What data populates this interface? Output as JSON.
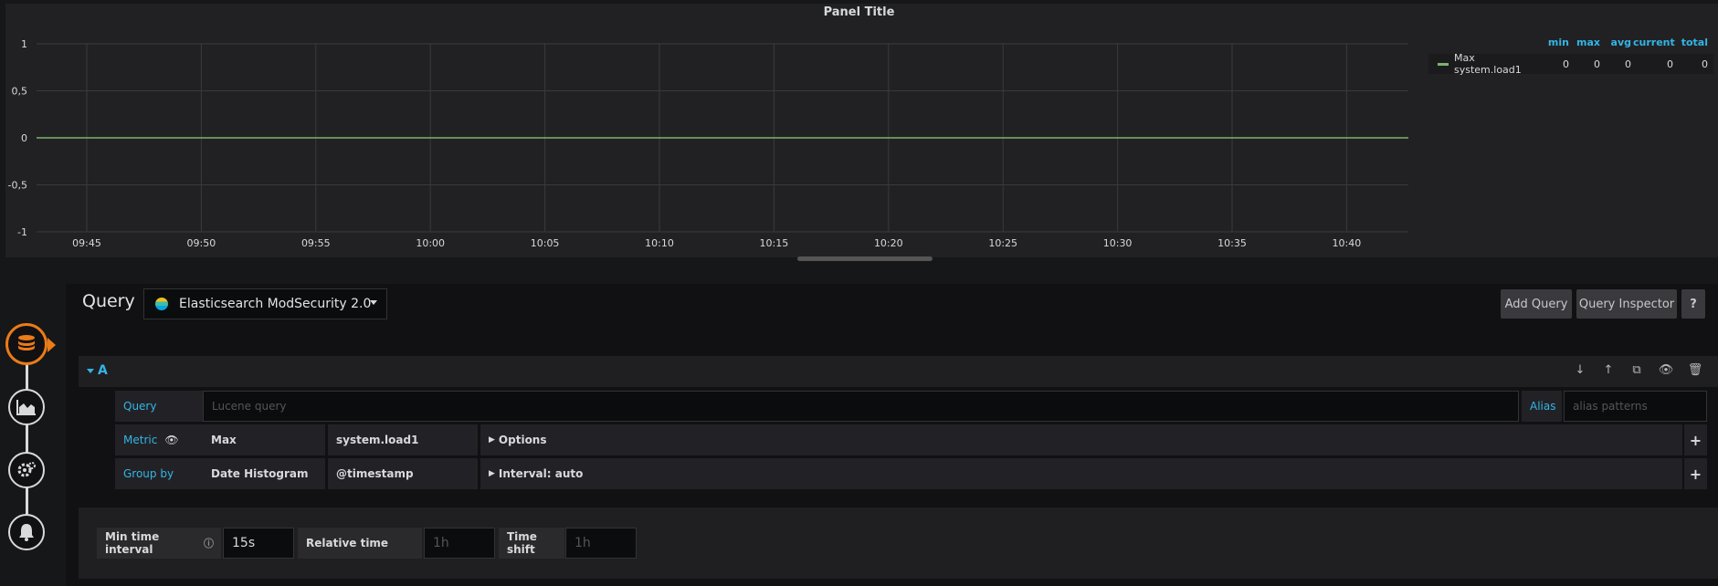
{
  "panel": {
    "title": "Panel Title",
    "legend": {
      "headers": [
        "min",
        "max",
        "avg",
        "current",
        "total"
      ],
      "series": [
        {
          "name": "Max system.load1",
          "color": "#7eb26d",
          "values": [
            "0",
            "0",
            "0",
            "0",
            "0"
          ]
        }
      ]
    }
  },
  "chart_data": {
    "type": "line",
    "title": "Panel Title",
    "x": [
      "09:45",
      "09:50",
      "09:55",
      "10:00",
      "10:05",
      "10:10",
      "10:15",
      "10:20",
      "10:25",
      "10:30",
      "10:35",
      "10:40"
    ],
    "y_ticks": [
      "1",
      "0,5",
      "0",
      "-0,5",
      "-1"
    ],
    "ylim": [
      -1,
      1
    ],
    "series": [
      {
        "name": "Max system.load1",
        "values": [
          0,
          0,
          0,
          0,
          0,
          0,
          0,
          0,
          0,
          0,
          0,
          0
        ],
        "color": "#7eb26d"
      }
    ],
    "grid": true,
    "legend": "right"
  },
  "editor": {
    "title": "Query",
    "datasource": "Elasticsearch ModSecurity 2.0",
    "add_query": "Add Query",
    "query_inspector": "Query Inspector",
    "help": "?",
    "row": {
      "letter": "A",
      "query_label": "Query",
      "query_placeholder": "Lucene query",
      "alias_label": "Alias",
      "alias_placeholder": "alias patterns",
      "metric_label": "Metric",
      "metric_type": "Max",
      "metric_field": "system.load1",
      "metric_options": "Options",
      "groupby_label": "Group by",
      "groupby_type": "Date Histogram",
      "groupby_field": "@timestamp",
      "groupby_options": "Interval: auto"
    },
    "options": {
      "min_interval_label": "Min time interval",
      "min_interval_value": "15s",
      "relative_time_label": "Relative time",
      "relative_time_placeholder": "1h",
      "time_shift_label": "Time shift",
      "time_shift_placeholder": "1h"
    }
  }
}
